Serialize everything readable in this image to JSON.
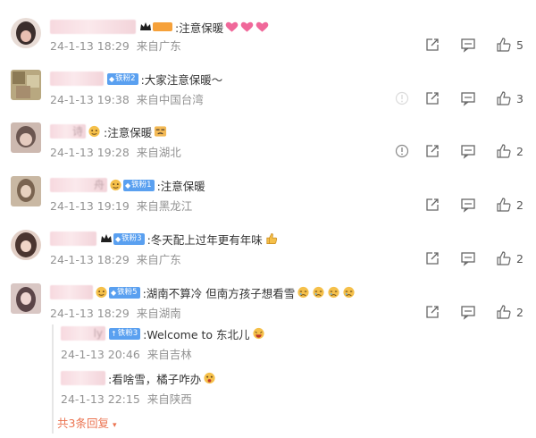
{
  "comments": [
    {
      "name_hint": "",
      "text": ":注意保暖",
      "time": "24-1-13 18:29",
      "location": "来自广东",
      "likes": "5",
      "badge": "",
      "badge_style": "orange",
      "emojis": [
        "heart-emoji",
        "heart-emoji",
        "heart-emoji"
      ]
    },
    {
      "name_hint": "",
      "text": ":大家注意保暖～",
      "time": "24-1-13 19:38",
      "location": "来自中国台湾",
      "likes": "3",
      "badge": "铁粉2",
      "badge_style": "blue",
      "emojis": []
    },
    {
      "name_hint": "诗",
      "text": ":注意保暖",
      "time": "24-1-13 19:28",
      "location": "来自湖北",
      "likes": "2",
      "badge": "",
      "badge_style": "orange",
      "emojis": [
        "sad-emoji"
      ]
    },
    {
      "name_hint": "舟",
      "text": ":注意保暖",
      "time": "24-1-13 19:19",
      "location": "来自黑龙江",
      "likes": "2",
      "badge": "铁粉1",
      "badge_style": "blue",
      "emojis": []
    },
    {
      "name_hint": "",
      "text": ":冬天配上过年更有年味",
      "time": "24-1-13 18:29",
      "location": "来自广东",
      "likes": "2",
      "badge": "铁粉3",
      "badge_style": "blue",
      "emojis": [
        "thumb-emoji"
      ]
    },
    {
      "name_hint": "",
      "text": ":湖南不算冷 但南方孩子想看雪",
      "time": "24-1-13 18:29",
      "location": "来自湖南",
      "likes": "2",
      "badge": "铁粉5",
      "badge_style": "blue",
      "emojis": [
        "cry-emoji",
        "cry-emoji",
        "cry-emoji",
        "cry-emoji"
      ]
    }
  ],
  "replies": [
    {
      "name_hint": "ly",
      "badge": "铁粉3",
      "text": ":Welcome to 东北儿",
      "time": "24-1-13 20:46",
      "location": "来自吉林"
    },
    {
      "name_hint": "",
      "badge": "",
      "text": ":看啥雪，橘子咋办",
      "time": "24-1-13 22:15",
      "location": "来自陕西"
    }
  ],
  "more_replies": "共3条回复",
  "colors": {
    "accent": "#eb7350",
    "meta": "#939393",
    "badge_blue": "#5aa0f0",
    "badge_orange": "#f6a13a"
  }
}
